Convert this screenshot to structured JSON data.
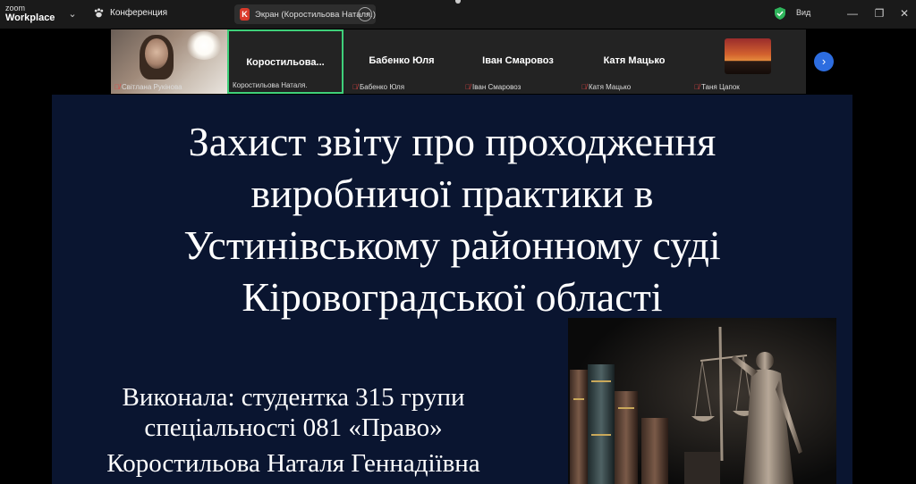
{
  "app": {
    "logo_line1": "zoom",
    "logo_line2": "Workplace",
    "conference_label": "Конференция",
    "share_badge": "K",
    "share_label": "Экран (Коростильова Наталя.)",
    "view_label": "Вид"
  },
  "participants": [
    {
      "display": "",
      "footer": "Світлана Рукінова",
      "muted": true,
      "video": true
    },
    {
      "display": "Коростильова...",
      "footer": "Коростильова Наталя.",
      "muted": false,
      "active": true
    },
    {
      "display": "Бабенко Юля",
      "footer": "Бабенко Юля",
      "muted": true
    },
    {
      "display": "Іван Смаровоз",
      "footer": "Іван Смаровоз",
      "muted": true
    },
    {
      "display": "Катя Мацько",
      "footer": "Катя Мацько",
      "muted": true
    },
    {
      "display": "",
      "footer": "Таня Цапок",
      "muted": true,
      "video": true
    }
  ],
  "slide": {
    "title_lines": [
      "Захист звіту про проходження",
      "виробничої практики в",
      "Устинівському районному суді",
      "Кіровоградської області"
    ],
    "author_lines": [
      "Виконала: студентка 315 групи",
      "спеціальності 081 «Право»"
    ],
    "author_name": "Коростильова Наталя Геннадіївна"
  },
  "colors": {
    "slide_bg": "#0a1530",
    "active_border": "#3fd07a",
    "mic_muted": "#e64545",
    "accent_blue": "#2d6de0"
  },
  "icons": [
    "chevron-down-icon",
    "paw-icon",
    "more-icon",
    "shield-check-icon",
    "minimize-icon",
    "restore-icon",
    "close-icon",
    "mic-muted-icon",
    "next-arrow-icon"
  ]
}
